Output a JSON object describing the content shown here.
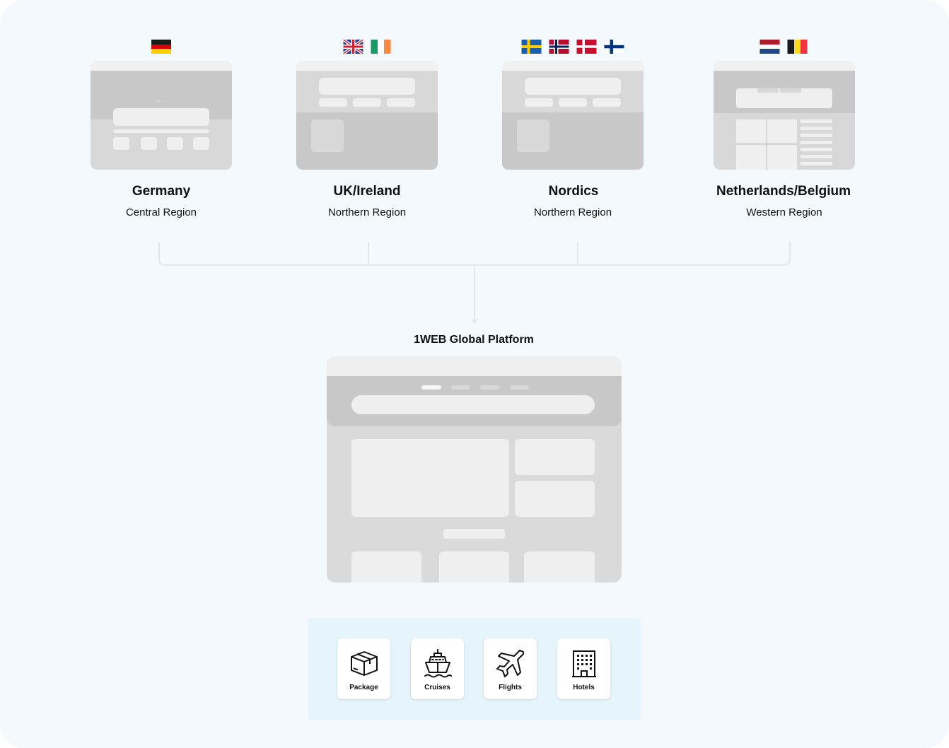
{
  "regions": [
    {
      "name": "Germany",
      "region": "Central Region",
      "flags": [
        "germany-flag-icon"
      ]
    },
    {
      "name": "UK/Ireland",
      "region": "Northern Region",
      "flags": [
        "uk-flag-icon",
        "ireland-flag-icon"
      ]
    },
    {
      "name": "Nordics",
      "region": "Northern Region",
      "flags": [
        "sweden-flag-icon",
        "norway-flag-icon",
        "denmark-flag-icon",
        "finland-flag-icon"
      ]
    },
    {
      "name": "Netherlands/Belgium",
      "region": "Western Region",
      "flags": [
        "netherlands-flag-icon",
        "belgium-flag-icon"
      ]
    }
  ],
  "platform": {
    "title": "1WEB Global Platform"
  },
  "services": [
    {
      "label": "Package",
      "icon": "package-box-icon"
    },
    {
      "label": "Cruises",
      "icon": "cruise-ship-icon"
    },
    {
      "label": "Flights",
      "icon": "airplane-icon"
    },
    {
      "label": "Hotels",
      "icon": "hotel-building-icon"
    }
  ],
  "colors": {
    "background": "#f4f9fd",
    "services_panel": "#e6f4fc",
    "connector": "#dde3e8"
  }
}
